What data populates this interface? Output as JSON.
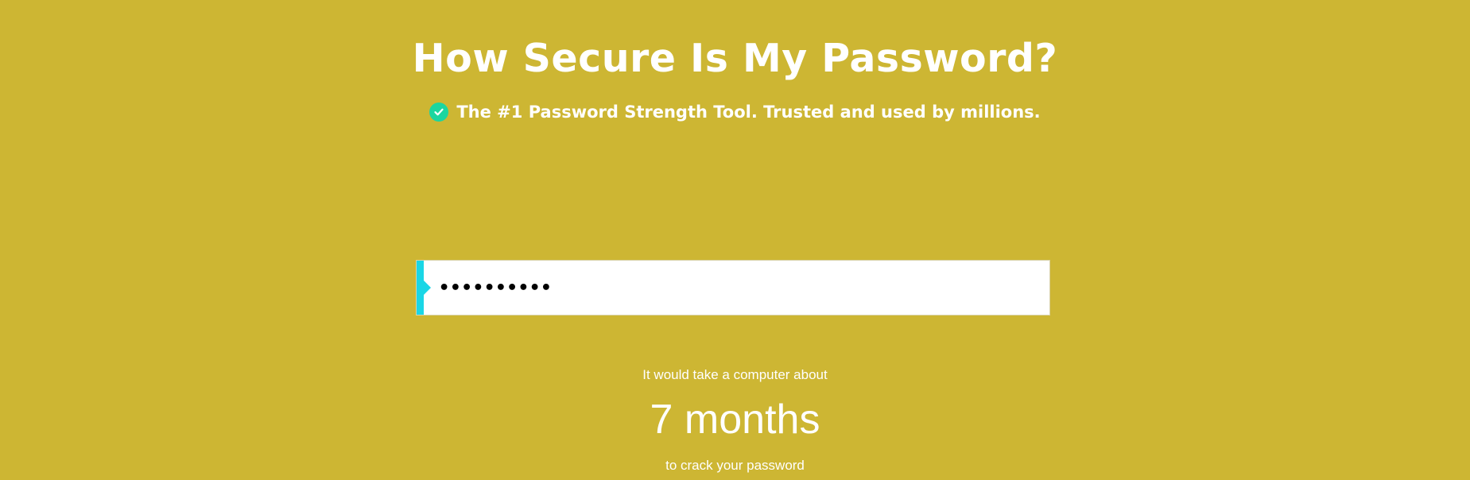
{
  "header": {
    "title": "How Secure Is My Password?",
    "tagline": "The #1 Password Strength Tool. Trusted and used by millions.",
    "tagline_icon": "check-circle-icon"
  },
  "password_input": {
    "value": "••••••••••"
  },
  "result": {
    "prefix": "It would take a computer about",
    "time": "7 months",
    "suffix": "to crack your password"
  },
  "colors": {
    "background": "#cdb633",
    "accent": "#1ad6e6",
    "check": "#1bd6a0",
    "text": "#ffffff"
  }
}
